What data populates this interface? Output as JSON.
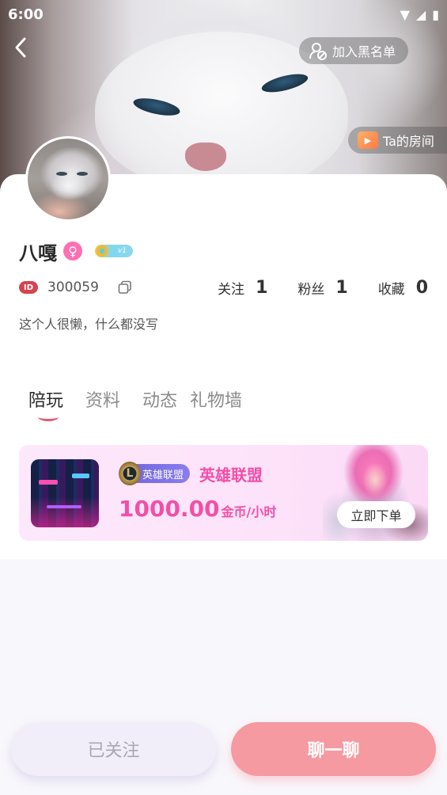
{
  "status_bar": {
    "time": "6:00"
  },
  "header": {
    "blacklist_label": "加入黑名单",
    "room_label": "Ta的房间"
  },
  "profile": {
    "name": "八嘎",
    "gender": "female",
    "vip_level": "v1",
    "id_badge": "ID",
    "id_number": "300059",
    "bio": "这个人很懒，什么都没写",
    "stats": [
      {
        "label": "关注",
        "value": "1"
      },
      {
        "label": "粉丝",
        "value": "1"
      },
      {
        "label": "收藏",
        "value": "0"
      }
    ]
  },
  "tabs": [
    {
      "label": "陪玩",
      "active": true
    },
    {
      "label": "资料",
      "active": false
    },
    {
      "label": "动态",
      "active": false
    },
    {
      "label": "礼物墙",
      "active": false
    }
  ],
  "service": {
    "tag": "英雄联盟",
    "game_name": "英雄联盟",
    "price": "1000.00",
    "price_unit": "金币/小时",
    "order_label": "立即下单"
  },
  "actions": {
    "follow_label": "已关注",
    "chat_label": "聊一聊"
  },
  "colors": {
    "accent_pink": "#f24fa8",
    "chat_button": "#f59aa0",
    "follow_button": "#f1eef9",
    "gender_badge": "#ff6fb3",
    "id_badge": "#d3454f"
  }
}
